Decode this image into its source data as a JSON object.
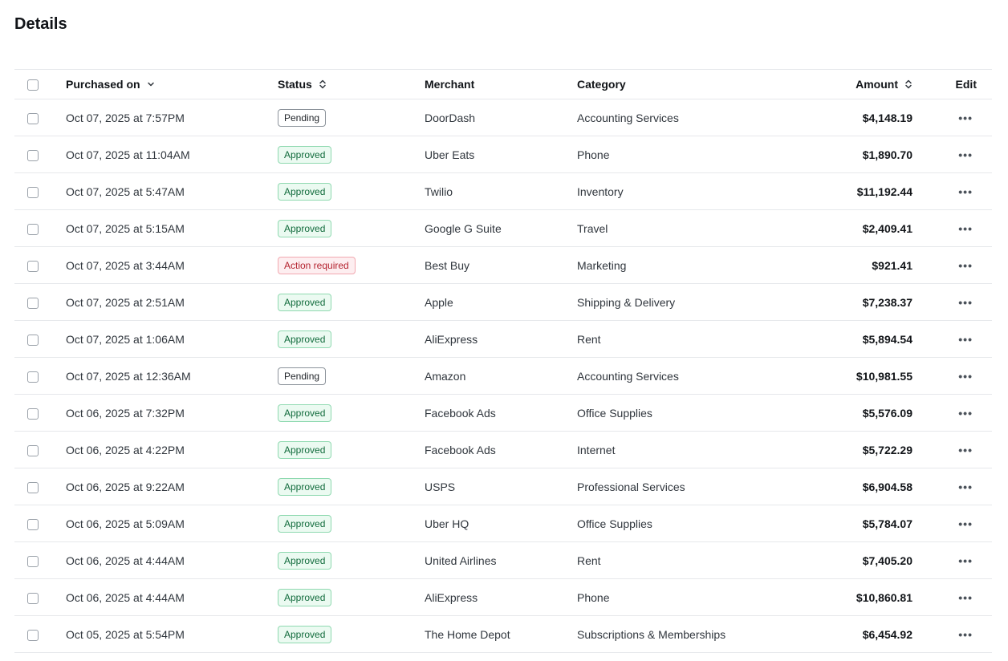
{
  "page": {
    "title": "Details"
  },
  "table": {
    "columns": {
      "purchased_on": "Purchased on",
      "status": "Status",
      "merchant": "Merchant",
      "category": "Category",
      "amount": "Amount",
      "edit": "Edit"
    },
    "rows": [
      {
        "date": "Oct 07, 2025 at 7:57PM",
        "status": "Pending",
        "status_type": "pending",
        "merchant": "DoorDash",
        "category": "Accounting Services",
        "amount": "$4,148.19"
      },
      {
        "date": "Oct 07, 2025 at 11:04AM",
        "status": "Approved",
        "status_type": "approved",
        "merchant": "Uber Eats",
        "category": "Phone",
        "amount": "$1,890.70"
      },
      {
        "date": "Oct 07, 2025 at 5:47AM",
        "status": "Approved",
        "status_type": "approved",
        "merchant": "Twilio",
        "category": "Inventory",
        "amount": "$11,192.44"
      },
      {
        "date": "Oct 07, 2025 at 5:15AM",
        "status": "Approved",
        "status_type": "approved",
        "merchant": "Google G Suite",
        "category": "Travel",
        "amount": "$2,409.41"
      },
      {
        "date": "Oct 07, 2025 at 3:44AM",
        "status": "Action required",
        "status_type": "action",
        "merchant": "Best Buy",
        "category": "Marketing",
        "amount": "$921.41"
      },
      {
        "date": "Oct 07, 2025 at 2:51AM",
        "status": "Approved",
        "status_type": "approved",
        "merchant": "Apple",
        "category": "Shipping & Delivery",
        "amount": "$7,238.37"
      },
      {
        "date": "Oct 07, 2025 at 1:06AM",
        "status": "Approved",
        "status_type": "approved",
        "merchant": "AliExpress",
        "category": "Rent",
        "amount": "$5,894.54"
      },
      {
        "date": "Oct 07, 2025 at 12:36AM",
        "status": "Pending",
        "status_type": "pending",
        "merchant": "Amazon",
        "category": "Accounting Services",
        "amount": "$10,981.55"
      },
      {
        "date": "Oct 06, 2025 at 7:32PM",
        "status": "Approved",
        "status_type": "approved",
        "merchant": "Facebook Ads",
        "category": "Office Supplies",
        "amount": "$5,576.09"
      },
      {
        "date": "Oct 06, 2025 at 4:22PM",
        "status": "Approved",
        "status_type": "approved",
        "merchant": "Facebook Ads",
        "category": "Internet",
        "amount": "$5,722.29"
      },
      {
        "date": "Oct 06, 2025 at 9:22AM",
        "status": "Approved",
        "status_type": "approved",
        "merchant": "USPS",
        "category": "Professional Services",
        "amount": "$6,904.58"
      },
      {
        "date": "Oct 06, 2025 at 5:09AM",
        "status": "Approved",
        "status_type": "approved",
        "merchant": "Uber HQ",
        "category": "Office Supplies",
        "amount": "$5,784.07"
      },
      {
        "date": "Oct 06, 2025 at 4:44AM",
        "status": "Approved",
        "status_type": "approved",
        "merchant": "United Airlines",
        "category": "Rent",
        "amount": "$7,405.20"
      },
      {
        "date": "Oct 06, 2025 at 4:44AM",
        "status": "Approved",
        "status_type": "approved",
        "merchant": "AliExpress",
        "category": "Phone",
        "amount": "$10,860.81"
      },
      {
        "date": "Oct 05, 2025 at 5:54PM",
        "status": "Approved",
        "status_type": "approved",
        "merchant": "The Home Depot",
        "category": "Subscriptions & Memberships",
        "amount": "$6,454.92"
      }
    ]
  },
  "icons": {
    "sort": "sort-icon",
    "row_menu": "more-horizontal-icon",
    "checkbox": "checkbox-icon"
  },
  "colors": {
    "approved_text": "#116b3c",
    "approved_bg": "#ebfaf1",
    "approved_border": "#8fd9b0",
    "action_text": "#b4232f",
    "action_bg": "#fdeef0",
    "action_border": "#f2a9b0",
    "pending_border": "#8c939b"
  }
}
